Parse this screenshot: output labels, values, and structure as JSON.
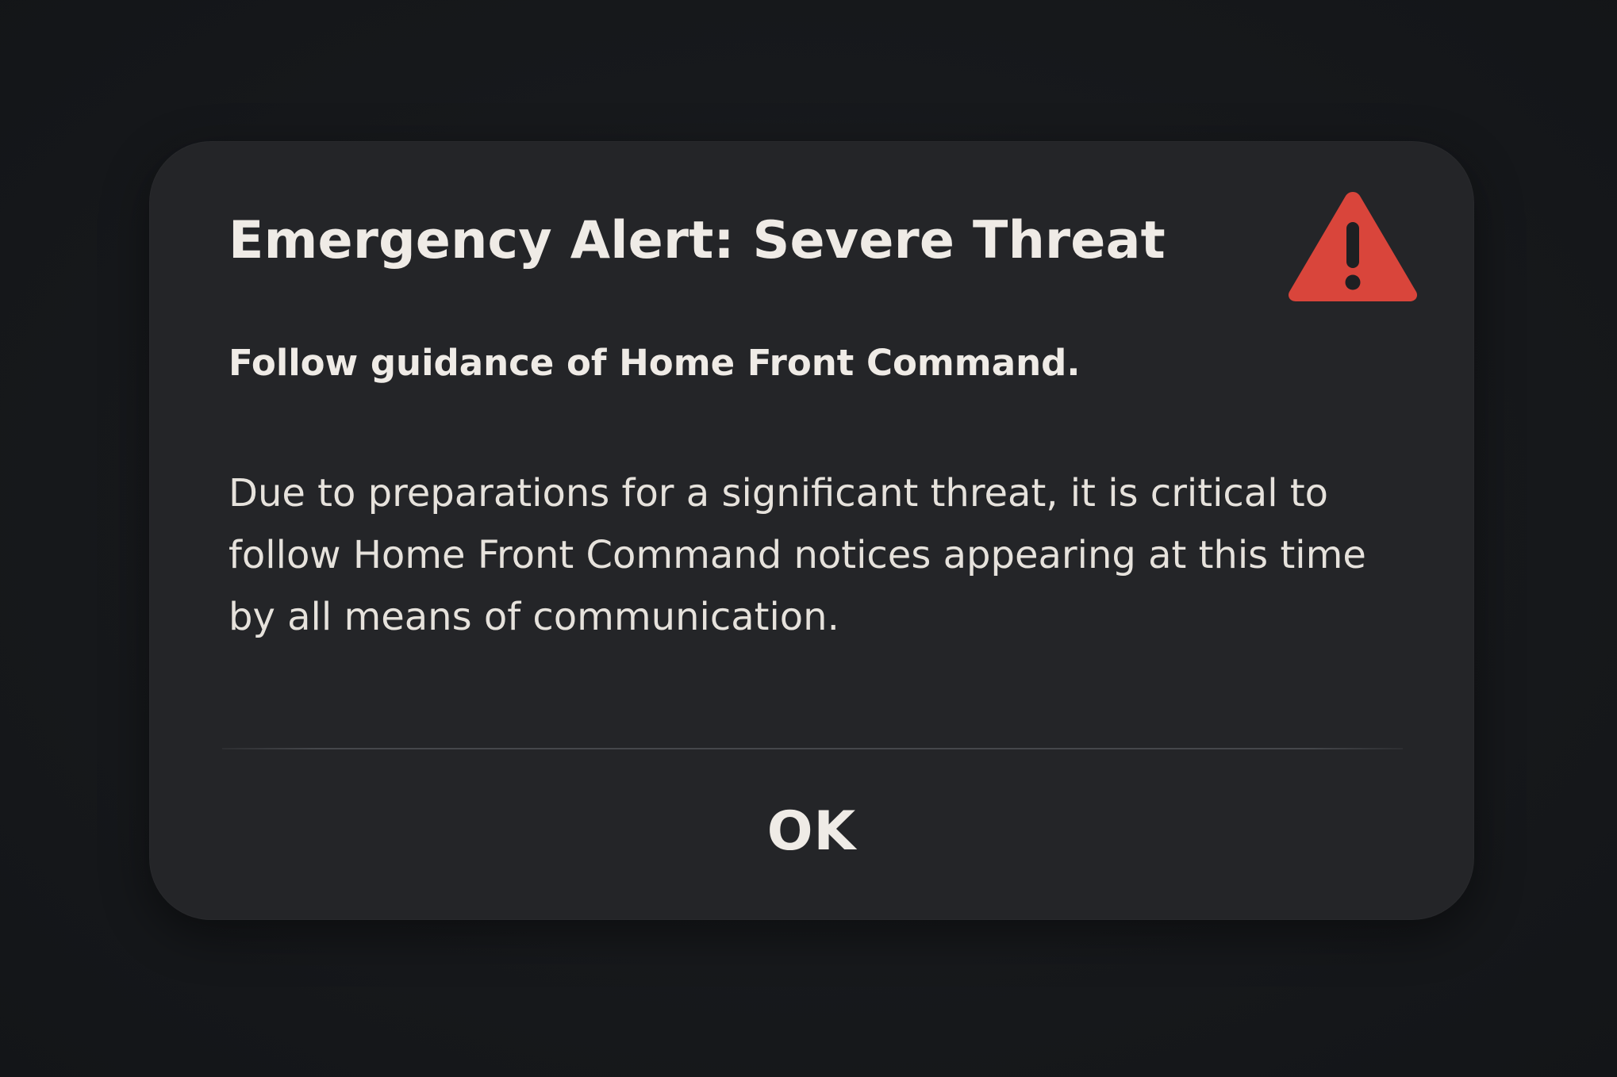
{
  "alert": {
    "title": "Emergency Alert: Severe Threat",
    "subtitle": "Follow guidance of Home Front Command.",
    "body": "Due to preparations for a significant threat, it is critical to follow Home Front Command notices appearing at this time by all means of communication.",
    "icon": "warning-triangle-icon",
    "icon_color": "#d9453b",
    "ok_label": "OK"
  },
  "colors": {
    "background": "#16181b",
    "dialog": "#242528",
    "text": "#efebe6"
  }
}
